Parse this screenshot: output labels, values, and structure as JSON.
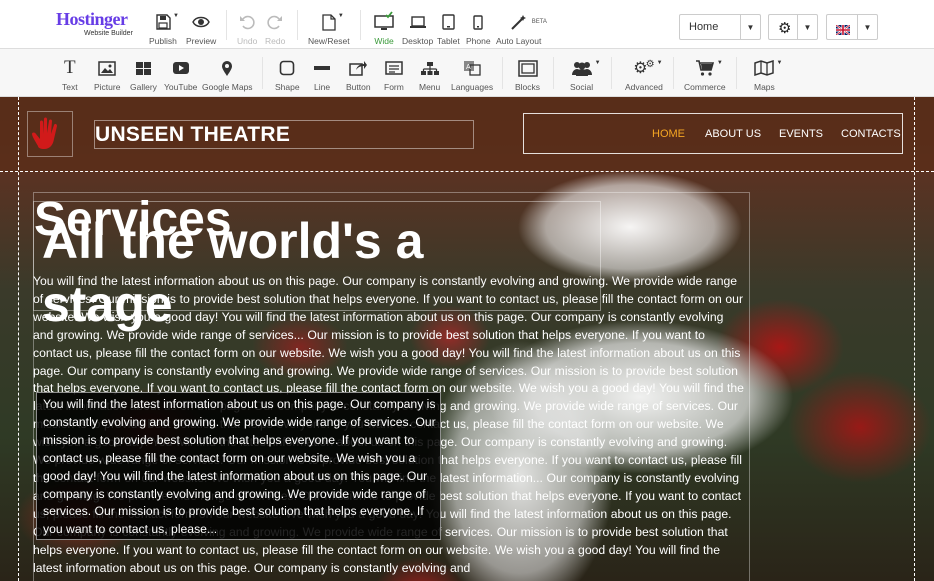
{
  "logo": {
    "brand": "Hostinger",
    "subtitle": "Website Builder"
  },
  "topbar": {
    "publish": "Publish",
    "preview": "Preview",
    "undo": "Undo",
    "redo": "Redo",
    "new_reset": "New/Reset",
    "wide": "Wide",
    "desktop": "Desktop",
    "tablet": "Tablet",
    "phone": "Phone",
    "auto_layout": "Auto Layout",
    "beta": "BETA",
    "page_select": "Home",
    "language_flag": "uk-flag-icon",
    "active_color": "#3a9a3a"
  },
  "elements": {
    "text": "Text",
    "picture": "Picture",
    "gallery": "Gallery",
    "youtube": "YouTube",
    "google_maps": "Google Maps",
    "shape": "Shape",
    "line": "Line",
    "button": "Button",
    "form": "Form",
    "menu": "Menu",
    "languages": "Languages",
    "blocks": "Blocks",
    "social": "Social",
    "advanced": "Advanced",
    "commerce": "Commerce",
    "maps": "Maps"
  },
  "site": {
    "title": "UNSEEN THEATRE",
    "menu": [
      "HOME",
      "ABOUT US",
      "EVENTS",
      "CONTACTS"
    ],
    "active_menu_color": "#f5a623",
    "heading_services": "Services",
    "heading_stage": "All the world's a stage",
    "body_text": "You will find the latest information about us on this page. Our company is constantly evolving and growing. We provide wide range of services. Our mission is to provide best solution that helps everyone. If you want to contact us, please fill the contact form on our website. We wish you a good day! You will find the latest information about us on this page. Our company is constantly evolving and growing. We provide wide range of services... Our mission is to provide best solution that helps everyone. If you want to contact us, please fill the contact form on our website. We wish you a good day! You will find the latest information about us on this page. Our company is constantly evolving and growing. We provide wide range of services. Our mission is to provide best solution that helps everyone. If you want to contact us, please fill the contact form on our website. We wish you a good day! You will find the latest information about us on this page. Our company is constantly evolving and growing. We provide wide range of services. Our mission is to provide best solution that helps everyone. If you want to contact us, please fill the contact form on our website. We wish you a good day! You will find the latest information about us on this page. Our company is constantly evolving and growing. We provide wide range of services. Our mission is to provide best solution that helps everyone. If you want to contact us, please fill the contact form on our website. We wish you a good day! You will find the latest information... Our company is constantly evolving and growing. We provide wide range of services. Our mission is to provide best solution that helps everyone. If you want to contact us, please fill the contact form on our website. We wish you a good day! You will find the latest information about us on this page. Our company is constantly evolving and growing. We provide wide range of services. Our mission is to provide best solution that helps everyone. If you want to contact us, please fill the contact form on our website. We wish you a good day! You will find the latest information about us on this page. Our company is constantly evolving and",
    "overlay_text": "You will find the latest information about us on this page. Our company is constantly evolving and growing. We provide wide range of services. Our mission is to provide best solution that helps everyone. If you want to contact us, please fill the contact form on our website. We wish you a good day! You will find the latest information about us on this page. Our company is constantly evolving and growing. We provide wide range of services. Our mission is to provide best solution that helps everyone. If you want to contact us, please..."
  }
}
